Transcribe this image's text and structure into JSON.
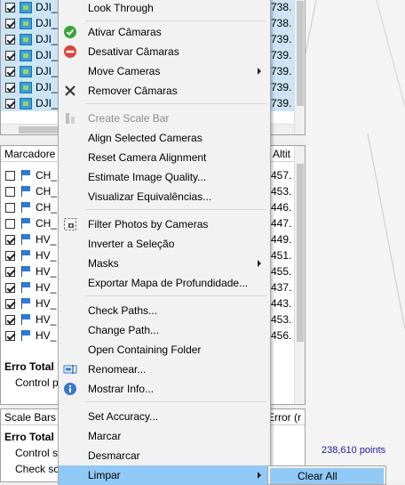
{
  "cameras_panel": {
    "rows": [
      {
        "label": "DJI_",
        "value": "738."
      },
      {
        "label": "DJI_",
        "value": "738."
      },
      {
        "label": "DJI_",
        "value": "739."
      },
      {
        "label": "DJI_",
        "value": "739."
      },
      {
        "label": "DJI_",
        "value": "739."
      },
      {
        "label": "DJI_",
        "value": "739."
      },
      {
        "label": "DJI_",
        "value": "739."
      }
    ]
  },
  "markers_panel": {
    "header_label": "Marcadore",
    "header_right": "Altit",
    "rows": [
      {
        "label": "CH_",
        "checked": false,
        "value": "457."
      },
      {
        "label": "CH_",
        "checked": false,
        "value": "453."
      },
      {
        "label": "CH_",
        "checked": false,
        "value": "446."
      },
      {
        "label": "CH_",
        "checked": false,
        "value": "447."
      },
      {
        "label": "HV_",
        "checked": true,
        "value": "449."
      },
      {
        "label": "HV_",
        "checked": true,
        "value": "451."
      },
      {
        "label": "HV_",
        "checked": true,
        "value": "455."
      },
      {
        "label": "HV_",
        "checked": true,
        "value": "437."
      },
      {
        "label": "HV_",
        "checked": true,
        "value": "443."
      },
      {
        "label": "HV_",
        "checked": true,
        "value": "453."
      },
      {
        "label": "HV_",
        "checked": true,
        "value": "456."
      }
    ],
    "total_label": "Erro Total",
    "control_label": "Control p"
  },
  "scalebars_panel": {
    "header_label": "Scale Bars",
    "header_right": "Error (r",
    "total_label": "Erro Total",
    "control_label": "Control s",
    "check_label": "Check sc"
  },
  "viewport": {
    "points_label": "238,610 points",
    "accent": "#1a1aa6"
  },
  "menu": {
    "look_through": "Look Through",
    "ativar": "Ativar Câmaras",
    "desativar": "Desativar Câmaras",
    "move": "Move Cameras",
    "remover": "Remover Câmaras",
    "create_scale_bar": "Create Scale Bar",
    "align_selected": "Align Selected Cameras",
    "reset_alignment": "Reset Camera Alignment",
    "estimate_quality": "Estimate Image Quality...",
    "visualizar": "Visualizar Equivalências...",
    "filter_photos": "Filter Photos by Cameras",
    "inverter": "Inverter a Seleção",
    "masks": "Masks",
    "exportar": "Exportar Mapa de Profundidade...",
    "check_paths": "Check Paths...",
    "change_path": "Change Path...",
    "open_folder": "Open Containing Folder",
    "renomear": "Renomear...",
    "mostrar_info": "Mostrar Info...",
    "set_accuracy": "Set Accuracy...",
    "marcar": "Marcar",
    "desmarcar": "Desmarcar",
    "limpar": "Limpar"
  },
  "submenu": {
    "clear_all": "Clear All"
  }
}
